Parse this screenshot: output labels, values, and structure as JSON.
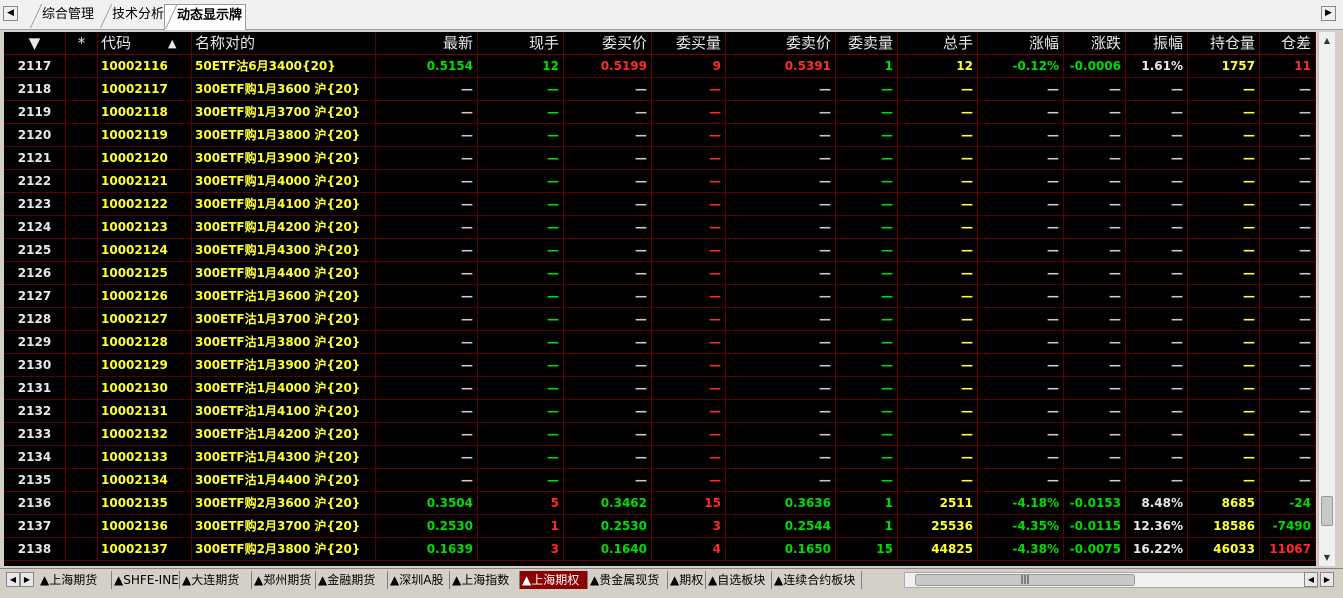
{
  "top_tabs": [
    "综合管理",
    "技术分析",
    "动态显示牌"
  ],
  "active_top_tab": 2,
  "header": {
    "sort_icon": "▼",
    "star": "*",
    "code": "代码",
    "code_sort": "▲",
    "name": "名称对的",
    "columns": [
      "最新",
      "现手",
      "委买价",
      "委买量",
      "委卖价",
      "委卖量",
      "总手",
      "涨幅",
      "涨跌",
      "振幅",
      "持仓量",
      "仓差"
    ]
  },
  "rows": [
    {
      "idx": "2117",
      "code": "10002116",
      "name": "50ETF沽6月3400{20}",
      "vals": [
        "0.5154",
        "12",
        "0.5199",
        "9",
        "0.5391",
        "1",
        "12",
        "-0.12%",
        "-0.0006",
        "1.61%",
        "1757",
        "11"
      ]
    },
    {
      "idx": "2118",
      "code": "10002117",
      "name": "300ETF购1月3600 沪{20}",
      "vals": [
        "—",
        "—",
        "—",
        "—",
        "—",
        "—",
        "—",
        "—",
        "—",
        "—",
        "—",
        "—"
      ]
    },
    {
      "idx": "2119",
      "code": "10002118",
      "name": "300ETF购1月3700 沪{20}",
      "vals": [
        "—",
        "—",
        "—",
        "—",
        "—",
        "—",
        "—",
        "—",
        "—",
        "—",
        "—",
        "—"
      ]
    },
    {
      "idx": "2120",
      "code": "10002119",
      "name": "300ETF购1月3800 沪{20}",
      "vals": [
        "—",
        "—",
        "—",
        "—",
        "—",
        "—",
        "—",
        "—",
        "—",
        "—",
        "—",
        "—"
      ]
    },
    {
      "idx": "2121",
      "code": "10002120",
      "name": "300ETF购1月3900 沪{20}",
      "vals": [
        "—",
        "—",
        "—",
        "—",
        "—",
        "—",
        "—",
        "—",
        "—",
        "—",
        "—",
        "—"
      ]
    },
    {
      "idx": "2122",
      "code": "10002121",
      "name": "300ETF购1月4000 沪{20}",
      "vals": [
        "—",
        "—",
        "—",
        "—",
        "—",
        "—",
        "—",
        "—",
        "—",
        "—",
        "—",
        "—"
      ]
    },
    {
      "idx": "2123",
      "code": "10002122",
      "name": "300ETF购1月4100 沪{20}",
      "vals": [
        "—",
        "—",
        "—",
        "—",
        "—",
        "—",
        "—",
        "—",
        "—",
        "—",
        "—",
        "—"
      ]
    },
    {
      "idx": "2124",
      "code": "10002123",
      "name": "300ETF购1月4200 沪{20}",
      "vals": [
        "—",
        "—",
        "—",
        "—",
        "—",
        "—",
        "—",
        "—",
        "—",
        "—",
        "—",
        "—"
      ]
    },
    {
      "idx": "2125",
      "code": "10002124",
      "name": "300ETF购1月4300 沪{20}",
      "vals": [
        "—",
        "—",
        "—",
        "—",
        "—",
        "—",
        "—",
        "—",
        "—",
        "—",
        "—",
        "—"
      ]
    },
    {
      "idx": "2126",
      "code": "10002125",
      "name": "300ETF购1月4400 沪{20}",
      "vals": [
        "—",
        "—",
        "—",
        "—",
        "—",
        "—",
        "—",
        "—",
        "—",
        "—",
        "—",
        "—"
      ]
    },
    {
      "idx": "2127",
      "code": "10002126",
      "name": "300ETF沽1月3600 沪{20}",
      "vals": [
        "—",
        "—",
        "—",
        "—",
        "—",
        "—",
        "—",
        "—",
        "—",
        "—",
        "—",
        "—"
      ]
    },
    {
      "idx": "2128",
      "code": "10002127",
      "name": "300ETF沽1月3700 沪{20}",
      "vals": [
        "—",
        "—",
        "—",
        "—",
        "—",
        "—",
        "—",
        "—",
        "—",
        "—",
        "—",
        "—"
      ]
    },
    {
      "idx": "2129",
      "code": "10002128",
      "name": "300ETF沽1月3800 沪{20}",
      "vals": [
        "—",
        "—",
        "—",
        "—",
        "—",
        "—",
        "—",
        "—",
        "—",
        "—",
        "—",
        "—"
      ]
    },
    {
      "idx": "2130",
      "code": "10002129",
      "name": "300ETF沽1月3900 沪{20}",
      "vals": [
        "—",
        "—",
        "—",
        "—",
        "—",
        "—",
        "—",
        "—",
        "—",
        "—",
        "—",
        "—"
      ]
    },
    {
      "idx": "2131",
      "code": "10002130",
      "name": "300ETF沽1月4000 沪{20}",
      "vals": [
        "—",
        "—",
        "—",
        "—",
        "—",
        "—",
        "—",
        "—",
        "—",
        "—",
        "—",
        "—"
      ]
    },
    {
      "idx": "2132",
      "code": "10002131",
      "name": "300ETF沽1月4100 沪{20}",
      "vals": [
        "—",
        "—",
        "—",
        "—",
        "—",
        "—",
        "—",
        "—",
        "—",
        "—",
        "—",
        "—"
      ]
    },
    {
      "idx": "2133",
      "code": "10002132",
      "name": "300ETF沽1月4200 沪{20}",
      "vals": [
        "—",
        "—",
        "—",
        "—",
        "—",
        "—",
        "—",
        "—",
        "—",
        "—",
        "—",
        "—"
      ]
    },
    {
      "idx": "2134",
      "code": "10002133",
      "name": "300ETF沽1月4300 沪{20}",
      "vals": [
        "—",
        "—",
        "—",
        "—",
        "—",
        "—",
        "—",
        "—",
        "—",
        "—",
        "—",
        "—"
      ]
    },
    {
      "idx": "2135",
      "code": "10002134",
      "name": "300ETF沽1月4400 沪{20}",
      "vals": [
        "—",
        "—",
        "—",
        "—",
        "—",
        "—",
        "—",
        "—",
        "—",
        "—",
        "—",
        "—"
      ]
    },
    {
      "idx": "2136",
      "code": "10002135",
      "name": "300ETF购2月3600 沪{20}",
      "vals": [
        "0.3504",
        "5",
        "0.3462",
        "15",
        "0.3636",
        "1",
        "2511",
        "-4.18%",
        "-0.0153",
        "8.48%",
        "8685",
        "-24"
      ]
    },
    {
      "idx": "2137",
      "code": "10002136",
      "name": "300ETF购2月3700 沪{20}",
      "vals": [
        "0.2530",
        "1",
        "0.2530",
        "3",
        "0.2544",
        "1",
        "25536",
        "-4.35%",
        "-0.0115",
        "12.36%",
        "18586",
        "-7490"
      ]
    },
    {
      "idx": "2138",
      "code": "10002137",
      "name": "300ETF购2月3800 沪{20}",
      "vals": [
        "0.1639",
        "3",
        "0.1640",
        "4",
        "0.1650",
        "15",
        "44825",
        "-4.38%",
        "-0.0075",
        "16.22%",
        "46033",
        "11067"
      ]
    }
  ],
  "colors": {
    "up": "#ff2a2a",
    "down": "#00dd00",
    "neutral": "#e8e8e8",
    "volume": "#ffff33",
    "grid_line": "#5a0000",
    "active_tab": "#8b0000"
  },
  "bottom_tabs": [
    "▲上海期货",
    "▲SHFE-INE",
    "▲大连期货",
    "▲郑州期货",
    "▲金融期货",
    "▲深圳A股",
    "▲上海指数",
    "▲上海期权",
    "▲贵金属现货",
    "▲期权",
    "▲自选板块",
    "▲连续合约板块"
  ],
  "active_bottom_tab": 7,
  "hscroll_grip": "|||"
}
